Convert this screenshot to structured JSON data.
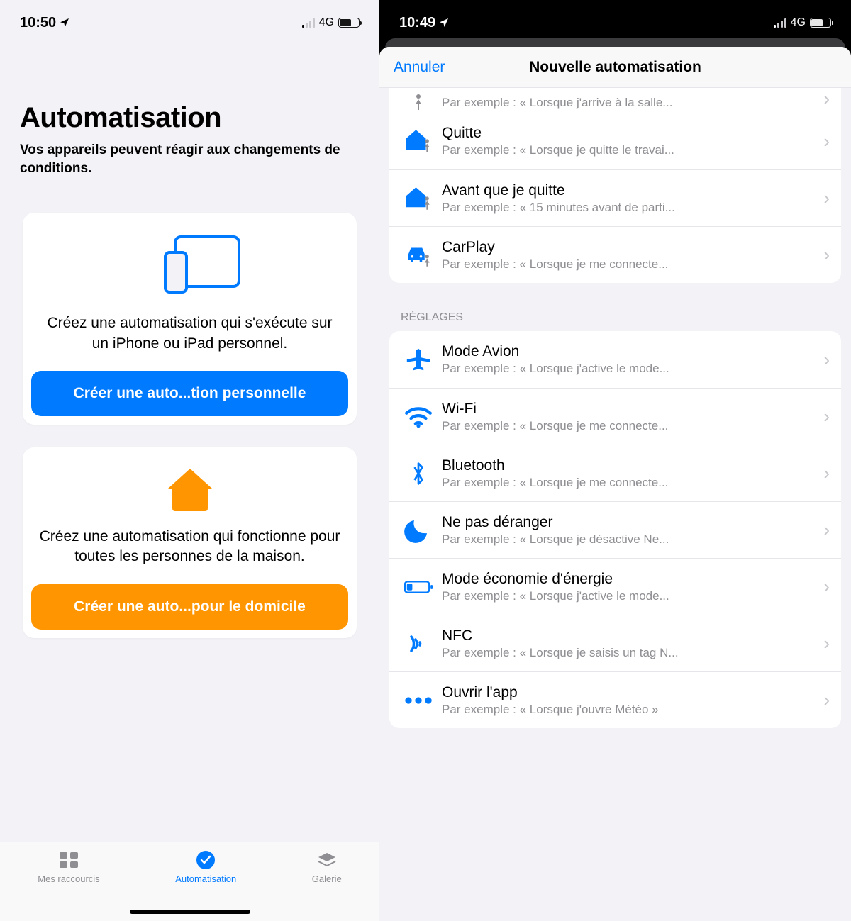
{
  "left": {
    "time": "10:50",
    "net": "4G",
    "title": "Automatisation",
    "subtitle": "Vos appareils peuvent réagir aux changements de conditions.",
    "card1": {
      "desc": "Créez une automatisation qui s'exécute sur un iPhone ou iPad personnel.",
      "button": "Créer une auto...tion personnelle"
    },
    "card2": {
      "desc": "Créez une automatisation qui fonctionne pour toutes les personnes de la maison.",
      "button": "Créer une auto...pour le domicile"
    },
    "tabs": {
      "shortcuts": "Mes raccourcis",
      "automation": "Automatisation",
      "gallery": "Galerie"
    }
  },
  "right": {
    "time": "10:49",
    "net": "4G",
    "cancel": "Annuler",
    "sheet_title": "Nouvelle automatisation",
    "partial_sub": "Par exemple : « Lorsque j'arrive à la salle...",
    "location_group": [
      {
        "title": "Quitte",
        "sub": "Par exemple : « Lorsque je quitte le travai...",
        "icon": "house-leave"
      },
      {
        "title": "Avant que je quitte",
        "sub": "Par exemple : « 15 minutes avant de parti...",
        "icon": "house-before"
      },
      {
        "title": "CarPlay",
        "sub": "Par exemple : « Lorsque je me connecte...",
        "icon": "car"
      }
    ],
    "section_label": "RÉGLAGES",
    "settings_group": [
      {
        "title": "Mode Avion",
        "sub": "Par exemple : « Lorsque j'active le mode...",
        "icon": "airplane"
      },
      {
        "title": "Wi-Fi",
        "sub": "Par exemple : « Lorsque je me connecte...",
        "icon": "wifi"
      },
      {
        "title": "Bluetooth",
        "sub": "Par exemple : « Lorsque je me connecte...",
        "icon": "bluetooth"
      },
      {
        "title": "Ne pas déranger",
        "sub": "Par exemple : « Lorsque je désactive Ne...",
        "icon": "moon"
      },
      {
        "title": "Mode économie d'énergie",
        "sub": "Par exemple : « Lorsque j'active le mode...",
        "icon": "battery-low"
      },
      {
        "title": "NFC",
        "sub": "Par exemple : « Lorsque je saisis un tag N...",
        "icon": "nfc"
      },
      {
        "title": "Ouvrir l'app",
        "sub": "Par exemple : « Lorsque j'ouvre Météo »",
        "icon": "app"
      }
    ]
  }
}
